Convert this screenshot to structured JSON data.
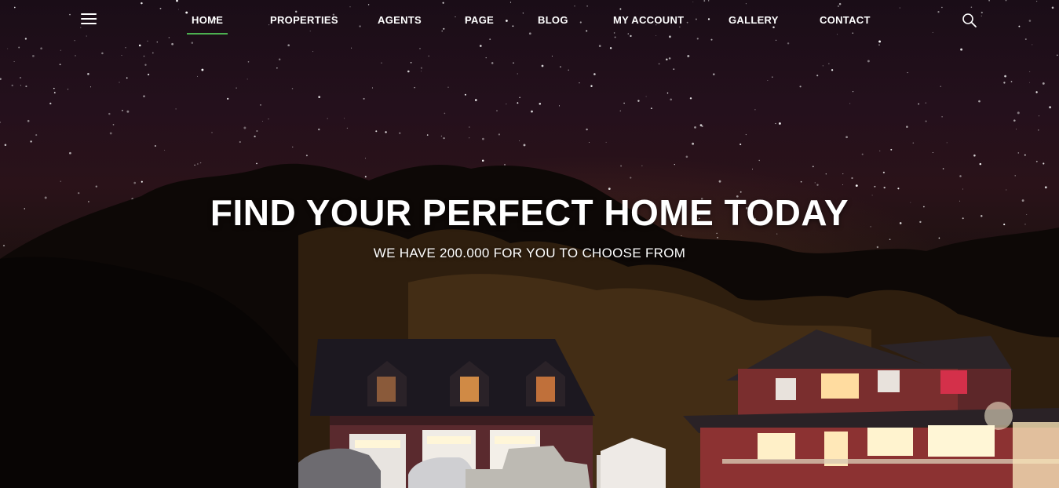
{
  "nav": {
    "items": [
      {
        "label": "HOME",
        "active": true
      },
      {
        "label": "PROPERTIES",
        "active": false
      },
      {
        "label": "AGENTS",
        "active": false
      },
      {
        "label": "PAGE",
        "active": false
      },
      {
        "label": "BLOG",
        "active": false
      },
      {
        "label": "MY ACCOUNT",
        "active": false
      },
      {
        "label": "GALLERY",
        "active": false
      },
      {
        "label": "CONTACT",
        "active": false
      }
    ],
    "menu_icon": "hamburger-menu-icon",
    "search_icon": "search-icon",
    "active_color": "#4caf50"
  },
  "hero": {
    "title": "FIND YOUR PERFECT HOME TODAY",
    "subtitle": "WE HAVE 200.000 FOR YOU TO CHOOSE FROM",
    "background": "night sky with stars over trees and lit houses"
  }
}
